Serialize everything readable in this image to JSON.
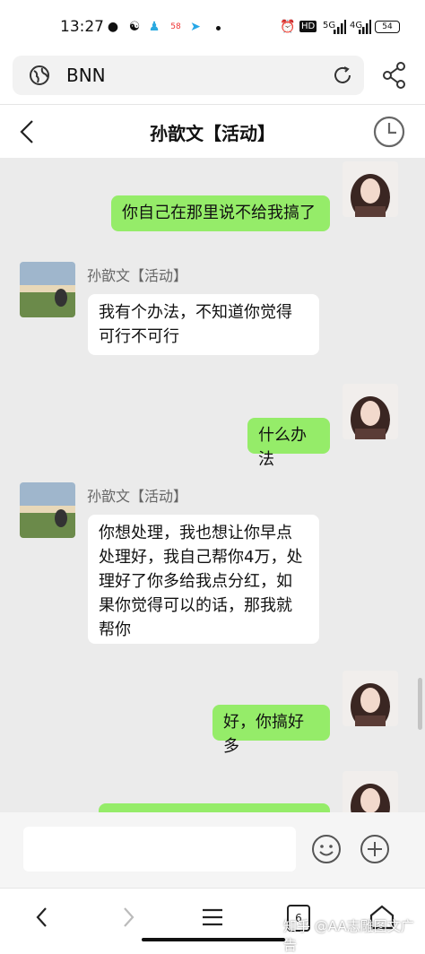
{
  "status_bar": {
    "time": "13:27",
    "icons": [
      "vpn-icon",
      "app-icon",
      "qq-icon",
      "58-app-icon",
      "send-icon"
    ],
    "right_icons": [
      "alarm-icon",
      "hd-icon",
      "signal-5g-icon",
      "signal-4g-icon"
    ],
    "hd": "HD",
    "net1": "5G",
    "net2": "4G",
    "battery": "54"
  },
  "browser": {
    "url": "BNN"
  },
  "chat": {
    "title": "孙歆文【活动】",
    "messages": [
      {
        "from": "me",
        "text": "你自己在那里说不给我搞了"
      },
      {
        "from": "them",
        "name": "孙歆文【活动】",
        "lines": [
          "我有个办法，不知道你觉得",
          "可行不可行"
        ]
      },
      {
        "from": "me",
        "text": "什么办法"
      },
      {
        "from": "them",
        "name": "孙歆文【活动】",
        "lines": [
          "你想处理，我也想让你早点",
          "处理好，我自己帮你4万，处",
          "理好了你多给我点分红，如",
          "果你觉得可以的话，那我就",
          "帮你"
        ]
      },
      {
        "from": "me",
        "text": "好，你搞好多"
      }
    ]
  },
  "input": {
    "placeholder": ""
  },
  "nav": {
    "tabs_count": "6"
  },
  "watermark": "知乎 @AA志雕图文广告",
  "colors": {
    "my_bubble": "#95ec69",
    "their_bubble": "#ffffff",
    "chat_bg": "#ebebeb"
  }
}
